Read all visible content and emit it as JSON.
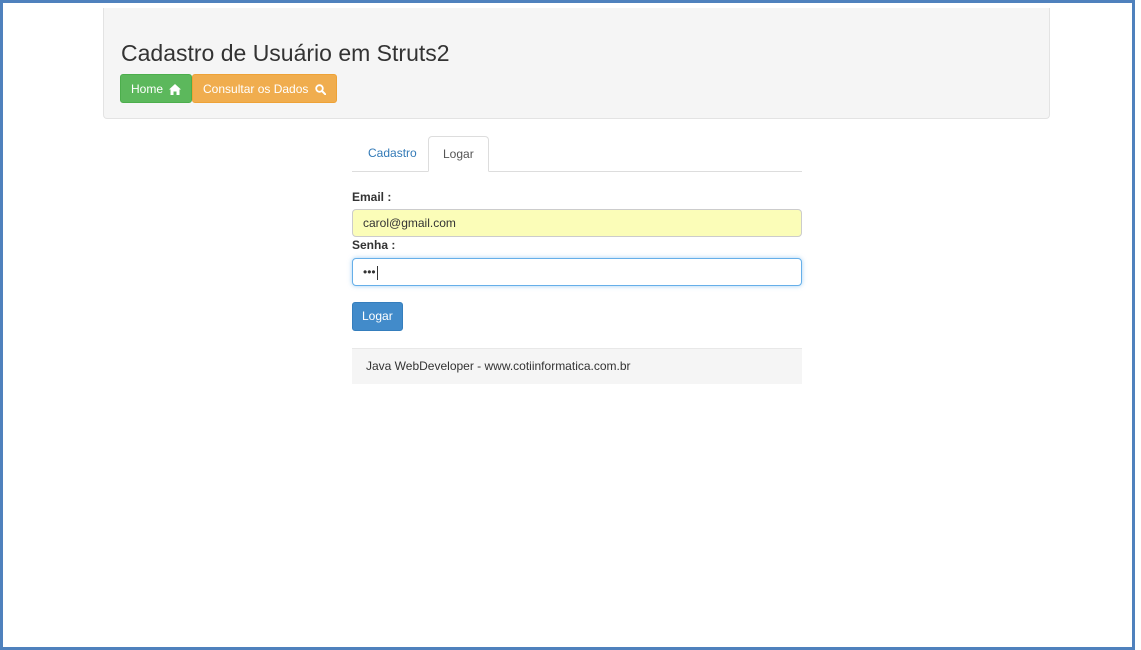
{
  "header": {
    "title": "Cadastro de Usuário em Struts2",
    "home_label": "Home",
    "consult_label": "Consultar os Dados"
  },
  "tabs": [
    {
      "label": "Cadastro",
      "active": false
    },
    {
      "label": "Logar",
      "active": true
    }
  ],
  "form": {
    "email_label": "Email :",
    "email_value": "carol@gmail.com",
    "senha_label": "Senha :",
    "senha_value": "•••",
    "submit_label": "Logar"
  },
  "footer": {
    "text": "Java WebDeveloper - www.cotiinformatica.com.br"
  },
  "colors": {
    "success": "#5cb85c",
    "warning": "#f0ad4e",
    "primary": "#428bca",
    "autofill": "#fbfdb8",
    "frame": "#4f81bd"
  },
  "icons": {
    "home": "home-icon",
    "search": "search-icon"
  }
}
